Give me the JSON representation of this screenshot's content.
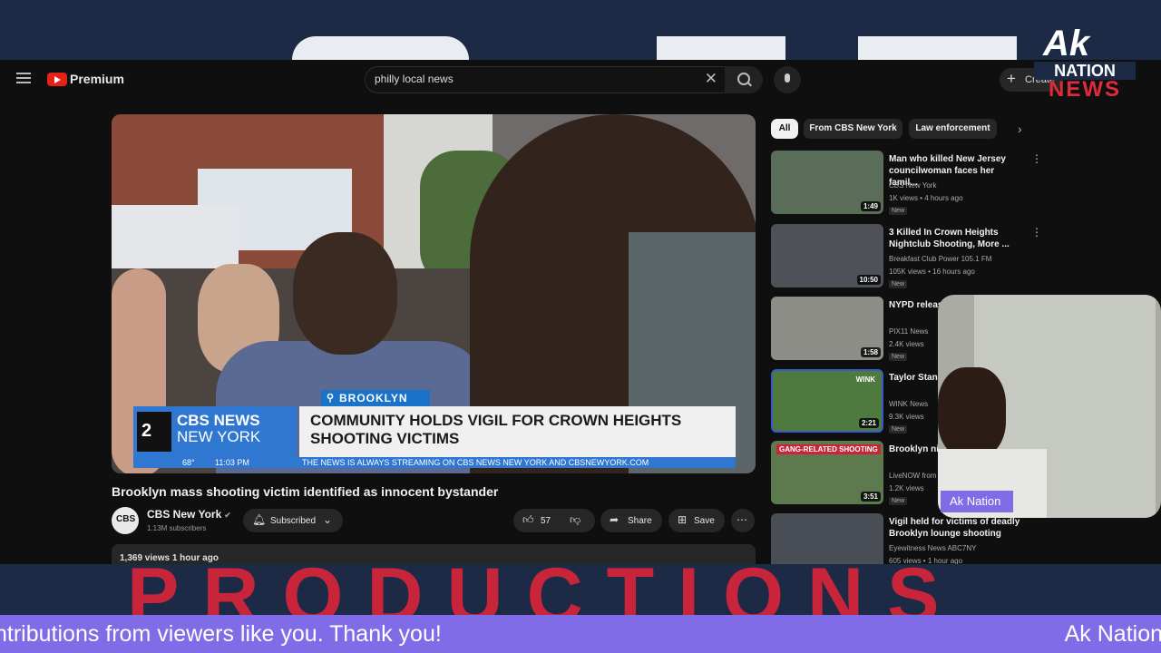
{
  "youtube": {
    "logo_text": "Premium",
    "search_value": "philly local news",
    "create_label": "Create"
  },
  "video": {
    "location_tag": "BROOKLYN",
    "station_line1": "CBS NEWS",
    "station_line2": "NEW YORK",
    "station_number": "2",
    "headline": "COMMUNITY HOLDS VIGIL FOR CROWN HEIGHTS SHOOTING VICTIMS",
    "temp": "68°",
    "time": "11:03 PM",
    "crawl": "THE NEWS IS ALWAYS STREAMING ON CBS NEWS NEW YORK AND CBSNEWYORK.COM",
    "title": "Brooklyn mass shooting victim identified as innocent bystander",
    "channel": "CBS New York",
    "subscribers": "1.13M subscribers",
    "subscribed_label": "Subscribed",
    "likes": "57",
    "share_label": "Share",
    "save_label": "Save",
    "description": "1,369 views  1 hour ago"
  },
  "chips": [
    "All",
    "From CBS New York",
    "Law enforcement"
  ],
  "recommendations": [
    {
      "title": "Man who killed New Jersey councilwoman faces her famil...",
      "channel": "CBS New York",
      "meta": "1K views • 4 hours ago",
      "badge": "New",
      "duration": "1:49"
    },
    {
      "title": "3 Killed In Crown Heights Nightclub Shooting, More ...",
      "channel": "Breakfast Club Power 105.1 FM",
      "meta": "105K views • 16 hours ago",
      "badge": "New",
      "duration": "10:50"
    },
    {
      "title": "NYPD releas... accused of ...",
      "channel": "PIX11 News",
      "meta": "2.4K views",
      "badge": "New",
      "duration": "1:58"
    },
    {
      "title": "Taylor Stani... Challenge g...",
      "channel": "WINK News",
      "meta": "9.3K views",
      "badge": "New",
      "duration": "2:21",
      "thumb_label": "WINK"
    },
    {
      "title": "Brooklyn ni... of 3 killed w...",
      "channel": "LiveNOW from",
      "meta": "1.2K views",
      "badge": "New",
      "duration": "3:51",
      "thumb_label": "GANG-RELATED SHOOTING"
    },
    {
      "title": "Vigil held for victims of deadly Brooklyn lounge shooting",
      "channel": "Eyewitness News ABC7NY",
      "meta": "605 views • 1 hour ago",
      "badge": "",
      "duration": ""
    }
  ],
  "overlay": {
    "cam_label": "Ak Nation",
    "logo_ak": "Ak",
    "logo_nation": "NATION",
    "logo_news": "NEWS",
    "ticker_left": "ntributions from viewers like you. Thank you!",
    "ticker_right": "Ak Nation",
    "background_text": "PRODUCTIONS"
  },
  "colors": {
    "ticker": "#7f6ce6",
    "brand_red": "#c8243a",
    "navy": "#1c2a45",
    "yt_red": "#e62117"
  }
}
